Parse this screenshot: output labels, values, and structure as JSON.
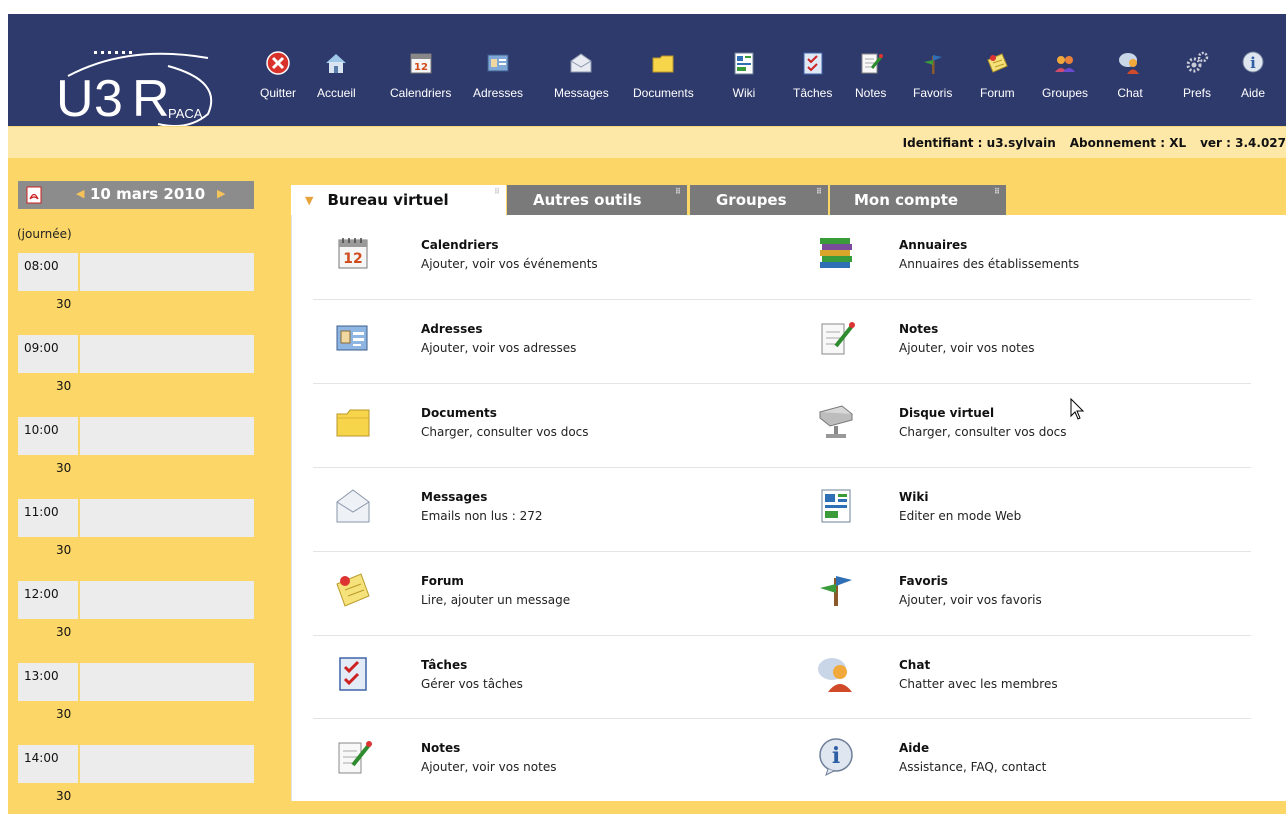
{
  "logo": {
    "text": "U3R",
    "sub": "PACA"
  },
  "nav": [
    {
      "label": "Quitter",
      "icon": "quit-icon"
    },
    {
      "label": "Accueil",
      "icon": "home-icon"
    },
    {
      "label": "Calendriers",
      "icon": "calendar-icon"
    },
    {
      "label": "Adresses",
      "icon": "address-card-icon"
    },
    {
      "label": "Messages",
      "icon": "envelope-icon"
    },
    {
      "label": "Documents",
      "icon": "folder-icon"
    },
    {
      "label": "Wiki",
      "icon": "wiki-icon"
    },
    {
      "label": "Tâches",
      "icon": "task-icon"
    },
    {
      "label": "Notes",
      "icon": "notes-icon"
    },
    {
      "label": "Favoris",
      "icon": "signpost-icon"
    },
    {
      "label": "Forum",
      "icon": "forum-icon"
    },
    {
      "label": "Groupes",
      "icon": "group-icon"
    },
    {
      "label": "Chat",
      "icon": "chat-icon"
    },
    {
      "label": "Prefs",
      "icon": "gears-icon"
    },
    {
      "label": "Aide",
      "icon": "help-icon"
    }
  ],
  "info": {
    "identifiant": "Identifiant : u3.sylvain",
    "abonnement": "Abonnement : XL",
    "version": "ver : 3.4.027"
  },
  "day": {
    "date": "10 mars 2010",
    "allday": "(journée)",
    "slots": [
      "08:00",
      "30",
      "09:00",
      "30",
      "10:00",
      "30",
      "11:00",
      "30",
      "12:00",
      "30",
      "13:00",
      "30",
      "14:00",
      "30"
    ]
  },
  "tabs": [
    {
      "label": "Bureau virtuel"
    },
    {
      "label": "Autres outils"
    },
    {
      "label": "Groupes"
    },
    {
      "label": "Mon compte"
    }
  ],
  "tools": {
    "left": [
      {
        "title": "Calendriers",
        "desc": "Ajouter, voir vos événements",
        "icon": "calendar-icon"
      },
      {
        "title": "Adresses",
        "desc": "Ajouter, voir vos adresses",
        "icon": "address-card-icon"
      },
      {
        "title": "Documents",
        "desc": "Charger, consulter vos docs",
        "icon": "folder-icon"
      },
      {
        "title": "Messages",
        "desc": "Emails non lus : 272",
        "icon": "envelope-icon"
      },
      {
        "title": "Forum",
        "desc": "Lire, ajouter un message",
        "icon": "forum-icon"
      },
      {
        "title": "Tâches",
        "desc": "Gérer vos tâches",
        "icon": "task-icon"
      },
      {
        "title": "Notes",
        "desc": "Ajouter, voir vos notes",
        "icon": "notes-icon"
      }
    ],
    "right": [
      {
        "title": "Annuaires",
        "desc": "Annuaires des établissements",
        "icon": "books-icon"
      },
      {
        "title": "Notes",
        "desc": "Ajouter, voir vos notes",
        "icon": "notes-icon"
      },
      {
        "title": "Disque virtuel",
        "desc": "Charger, consulter vos docs",
        "icon": "disk-icon"
      },
      {
        "title": "Wiki",
        "desc": "Editer en mode Web",
        "icon": "wiki-icon"
      },
      {
        "title": "Favoris",
        "desc": "Ajouter, voir vos favoris",
        "icon": "signpost-icon"
      },
      {
        "title": "Chat",
        "desc": "Chatter avec les membres",
        "icon": "chat-icon"
      },
      {
        "title": "Aide",
        "desc": "Assistance, FAQ, contact",
        "icon": "help-icon"
      }
    ]
  },
  "colors": {
    "nav_bg": "#2f3a6c",
    "info_bg": "#fde8a8",
    "content_bg": "#fcd768",
    "tab_inactive": "#7a7a7a",
    "day_header": "#8c8c8c"
  }
}
